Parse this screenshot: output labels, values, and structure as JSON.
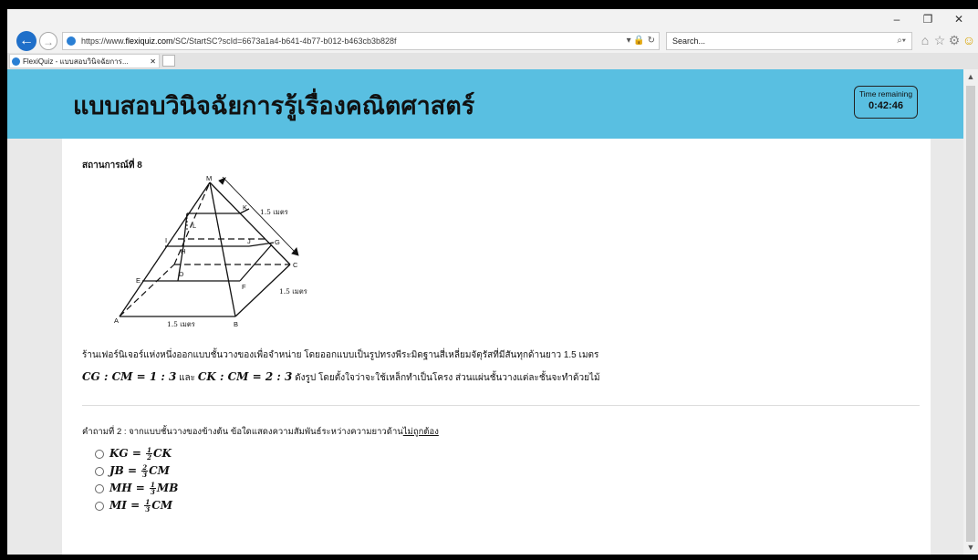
{
  "browser": {
    "url_prefix": "https://www.",
    "url_host": "flexiquiz.com",
    "url_path": "/SC/StartSC?scId=6673a1a4-b641-4b77-b012-b463cb3b828f",
    "url_tools": "▾ 🔒 ↻",
    "search_placeholder": "Search...",
    "search_icon": "⌕▾",
    "window_controls": [
      "–",
      "❐",
      "✕"
    ],
    "toolbar_icons": [
      "⌂",
      "☆",
      "⚙",
      "☺"
    ],
    "tab_title": "FlexiQuiz - แบบสอบวินิจฉัยการ...",
    "tab_close": "✕"
  },
  "page": {
    "title": "แบบสอบวินิจฉัยการรู้เรื่องคณิตศาสตร์",
    "timer_label": "Time remaining",
    "timer_value": "0:42:46",
    "scenario": "สถานการณ์ที่ 8",
    "figure_labels": {
      "M": "M",
      "K": "K",
      "L": "L",
      "I": "I",
      "J": "J",
      "H": "H",
      "G": "G",
      "E": "E",
      "D": "D",
      "F": "F",
      "C": "C",
      "A": "A",
      "B": "B",
      "dim_slant": "1.5 เมตร",
      "dim_right": "1.5 เมตร",
      "dim_bottom": "1.5 เมตร"
    },
    "paragraph": "ร้านเฟอร์นิเจอร์แห่งหนึ่งออกแบบชั้นวางของเพื่อจำหน่าย โดยออกแบบเป็นรูปทรงพีระมิดฐานสี่เหลี่ยมจัตุรัสที่มีสันทุกด้านยาว 1.5 เมตร",
    "ratio_1": "CG : CM = 1 : 3",
    "ratio_and": " และ ",
    "ratio_2": "CK : CM = 2 : 3",
    "ratio_rest": " ดังรูป โดยตั้งใจว่าจะใช้เหล็กทำเป็นโครง ส่วนแผ่นชั้นวางแต่ละชั้นจะทำด้วยไม้",
    "question_prefix": "คำถามที่ 2 :  จากแบบชั้นวางของข้างต้น ข้อใดแสดงความสัมพันธ์ระหว่างความยาวด้าน",
    "question_emph": "ไม่ถูกต้อง",
    "options": [
      {
        "left": "KG = ",
        "num": "1",
        "den": "2",
        "right": "CK"
      },
      {
        "left": "JB = ",
        "num": "2",
        "den": "3",
        "right": "CM"
      },
      {
        "left": "MH = ",
        "num": "1",
        "den": "3",
        "right": "MB"
      },
      {
        "left": "MI = ",
        "num": "1",
        "den": "3",
        "right": "CM"
      }
    ]
  },
  "scroll": {
    "up": "▲",
    "down": "▼"
  }
}
